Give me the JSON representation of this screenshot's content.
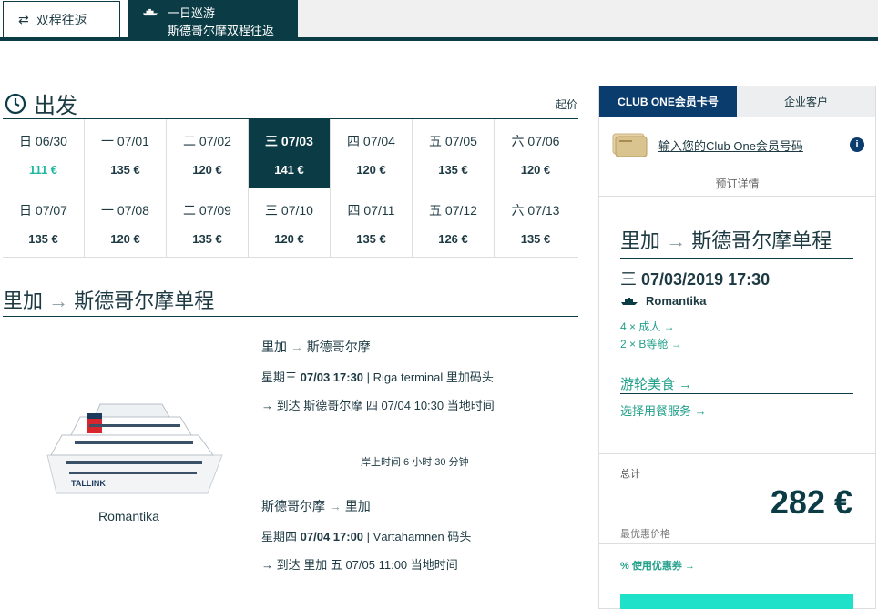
{
  "tabs": {
    "roundtrip": "双程往返",
    "cruise_line1": "一日巡游",
    "cruise_line2": "斯德哥尔摩双程往返"
  },
  "departure": {
    "title": "出发",
    "from_price_label": "起价",
    "week1": [
      {
        "date": "日 06/30",
        "price": "111 €",
        "style": "cheap"
      },
      {
        "date": "一 07/01",
        "price": "135 €"
      },
      {
        "date": "二 07/02",
        "price": "120 €"
      },
      {
        "date": "三 07/03",
        "price": "141 €",
        "style": "selected"
      },
      {
        "date": "四 07/04",
        "price": "120 €"
      },
      {
        "date": "五 07/05",
        "price": "135 €"
      },
      {
        "date": "六 07/06",
        "price": "120 €"
      }
    ],
    "week2": [
      {
        "date": "日 07/07",
        "price": "135 €"
      },
      {
        "date": "一 07/08",
        "price": "120 €"
      },
      {
        "date": "二 07/09",
        "price": "135 €"
      },
      {
        "date": "三 07/10",
        "price": "120 €"
      },
      {
        "date": "四 07/11",
        "price": "135 €"
      },
      {
        "date": "五 07/12",
        "price": "126 €"
      },
      {
        "date": "六 07/13",
        "price": "135 €"
      }
    ]
  },
  "route": {
    "from": "里加",
    "arrow": "→",
    "to": "斯德哥尔摩单程"
  },
  "ship": {
    "name": "Romantika",
    "logo_text": "TALLINK"
  },
  "leg1": {
    "from": "里加",
    "to": "斯德哥尔摩",
    "dep_day": "星期三",
    "dep_date": "07/03 17:30",
    "dep_port": "| Riga terminal 里加码头",
    "arrive": "→ 到达 斯德哥尔摩 四 07/04 10:30 当地时间"
  },
  "shore_time": "岸上时间 6 小时 30 分钟",
  "leg2": {
    "from": "斯德哥尔摩",
    "to": "里加",
    "dep_day": "星期四",
    "dep_date": "07/04 17:00",
    "dep_port": "| Värtahamnen 码头",
    "arrive": "→ 到达 里加 五 07/05 11:00 当地时间"
  },
  "panel": {
    "tab_club": "CLUB ONE会员卡号",
    "tab_corp": "企业客户",
    "club_link": "输入您的Club One会员号码",
    "info": "i",
    "booking_details": "预订详情",
    "route_from": "里加",
    "route_to": "斯德哥尔摩单程",
    "date_day": "三",
    "date_value": "07/03/2019 17:30",
    "ship": "Romantika",
    "adults": "4 × 成人 →",
    "cabin": "2 × B等舱 →",
    "dining": "游轮美食 →",
    "service": "选择用餐服务 →",
    "total_label": "总计",
    "total": "282 €",
    "best_price": "最优惠价格",
    "coupon": "% 使用优惠券 →"
  },
  "colors": {
    "primary": "#0b3c46",
    "accent": "#21b8a0",
    "club_blue": "#0b3c6e",
    "cta": "#1fe0c8"
  }
}
